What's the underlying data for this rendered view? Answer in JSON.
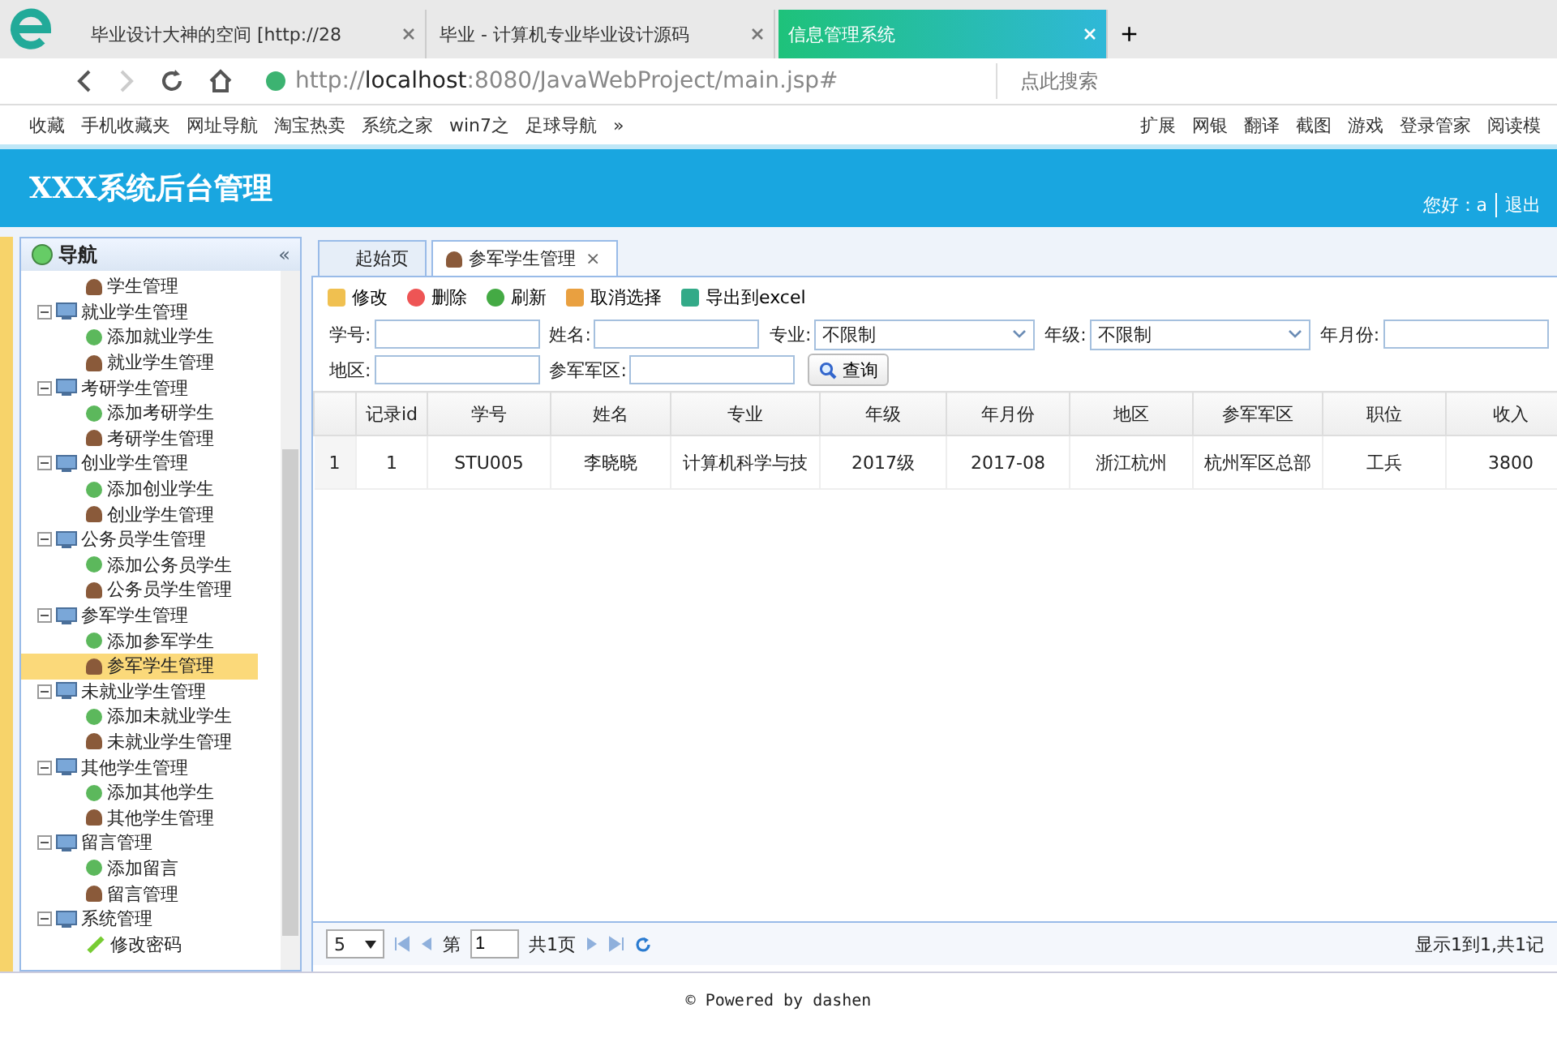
{
  "browser": {
    "tabs": [
      {
        "label": "毕业设计大神的空间 [http://28",
        "selected": false
      },
      {
        "label": "毕业 - 计算机专业毕业设计源码",
        "selected": false
      },
      {
        "label": "信息管理系统",
        "selected": true
      }
    ],
    "new_tab": "+",
    "url_prefix": "http://",
    "url_host": "localhost",
    "url_rest": ":8080/JavaWebProject/main.jsp#",
    "search": {
      "placeholder": "点此搜索"
    },
    "bookmarks": [
      "收藏",
      "手机收藏夹",
      "网址导航",
      "淘宝热卖",
      "系统之家",
      "win7之",
      "足球导航"
    ],
    "bookmarks_more": "»",
    "tools": [
      "扩展",
      "网银",
      "翻译",
      "截图",
      "游戏",
      "登录管家",
      "阅读模"
    ]
  },
  "header": {
    "title": "XXX系统后台管理",
    "greeting": "您好：a",
    "logout": "退出"
  },
  "nav": {
    "title": "导航",
    "collapse": "«",
    "tree": [
      {
        "label": "学生管理",
        "kind": "manage",
        "selected": false
      },
      {
        "label": "就业学生管理",
        "expanded": true,
        "children": [
          {
            "label": "添加就业学生",
            "kind": "add",
            "selected": false
          },
          {
            "label": "就业学生管理",
            "kind": "manage",
            "selected": false
          }
        ]
      },
      {
        "label": "考研学生管理",
        "expanded": true,
        "children": [
          {
            "label": "添加考研学生",
            "kind": "add",
            "selected": false
          },
          {
            "label": "考研学生管理",
            "kind": "manage",
            "selected": false
          }
        ]
      },
      {
        "label": "创业学生管理",
        "expanded": true,
        "children": [
          {
            "label": "添加创业学生",
            "kind": "add",
            "selected": false
          },
          {
            "label": "创业学生管理",
            "kind": "manage",
            "selected": false
          }
        ]
      },
      {
        "label": "公务员学生管理",
        "expanded": true,
        "children": [
          {
            "label": "添加公务员学生",
            "kind": "add",
            "selected": false
          },
          {
            "label": "公务员学生管理",
            "kind": "manage",
            "selected": false
          }
        ]
      },
      {
        "label": "参军学生管理",
        "expanded": true,
        "children": [
          {
            "label": "添加参军学生",
            "kind": "add",
            "selected": false
          },
          {
            "label": "参军学生管理",
            "kind": "manage",
            "selected": true
          }
        ]
      },
      {
        "label": "未就业学生管理",
        "expanded": true,
        "children": [
          {
            "label": "添加未就业学生",
            "kind": "add",
            "selected": false
          },
          {
            "label": "未就业学生管理",
            "kind": "manage",
            "selected": false
          }
        ]
      },
      {
        "label": "其他学生管理",
        "expanded": true,
        "children": [
          {
            "label": "添加其他学生",
            "kind": "add",
            "selected": false
          },
          {
            "label": "其他学生管理",
            "kind": "manage",
            "selected": false
          }
        ]
      },
      {
        "label": "留言管理",
        "expanded": true,
        "children": [
          {
            "label": "添加留言",
            "kind": "add",
            "selected": false
          },
          {
            "label": "留言管理",
            "kind": "manage",
            "selected": false
          }
        ]
      },
      {
        "label": "系统管理",
        "expanded": true,
        "children": [
          {
            "label": "修改密码",
            "kind": "edit",
            "selected": false
          }
        ]
      }
    ]
  },
  "tabs": [
    {
      "label": "起始页",
      "selected": false,
      "closable": false
    },
    {
      "label": "参军学生管理",
      "selected": true,
      "closable": true
    }
  ],
  "tab_close": "×",
  "toolbar": [
    {
      "label": "修改",
      "kind": "edit"
    },
    {
      "label": "删除",
      "kind": "delete"
    },
    {
      "label": "刷新",
      "kind": "refresh"
    },
    {
      "label": "取消选择",
      "kind": "cancel"
    },
    {
      "label": "导出到excel",
      "kind": "export"
    }
  ],
  "filters": [
    [
      {
        "label": "学号:",
        "kind": "text"
      },
      {
        "label": "姓名:",
        "kind": "text"
      },
      {
        "label": "专业:",
        "kind": "select",
        "value": "不限制"
      },
      {
        "label": "年级:",
        "kind": "select",
        "value": "不限制"
      },
      {
        "label": "年月份:",
        "kind": "text"
      }
    ],
    [
      {
        "label": "地区:",
        "kind": "text"
      },
      {
        "label": "参军军区:",
        "kind": "text"
      }
    ]
  ],
  "query_button": "查询",
  "table": {
    "columns": [
      "",
      "记录id",
      "学号",
      "姓名",
      "专业",
      "年级",
      "年月份",
      "地区",
      "参军军区",
      "职位",
      "收入"
    ],
    "rows": [
      [
        "1",
        "1",
        "STU005",
        "李晓晓",
        "计算机科学与技",
        "2017级",
        "2017-08",
        "浙江杭州",
        "杭州军区总部",
        "工兵",
        "3800"
      ]
    ]
  },
  "pager": {
    "page_size": "5",
    "page_prefix": "第",
    "page": "1",
    "page_total": "共1页",
    "summary": "显示1到1,共1记"
  },
  "footer": "© Powered by dashen"
}
